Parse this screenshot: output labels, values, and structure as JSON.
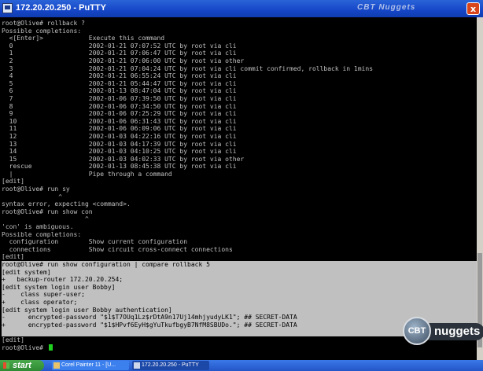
{
  "window": {
    "title": "172.20.20.250 - PuTTY",
    "watermark": "CBT Nuggets",
    "close_label": "x"
  },
  "terminal": {
    "lines": [
      "root@Olive# rollback ?",
      "Possible completions:",
      "  <[Enter]>            Execute this command",
      "  0                    2002-01-21 07:07:52 UTC by root via cli",
      "  1                    2002-01-21 07:06:47 UTC by root via cli",
      "  2                    2002-01-21 07:06:00 UTC by root via other",
      "  3                    2002-01-21 07:04:24 UTC by root via cli commit confirmed, rollback in 1mins",
      "  4                    2002-01-21 06:55:24 UTC by root via cli",
      "  5                    2002-01-21 05:44:47 UTC by root via cli",
      "  6                    2002-01-13 08:47:04 UTC by root via cli",
      "  7                    2002-01-06 07:39:50 UTC by root via cli",
      "  8                    2002-01-06 07:34:50 UTC by root via cli",
      "  9                    2002-01-06 07:25:29 UTC by root via cli",
      "  10                   2002-01-06 06:31:43 UTC by root via cli",
      "  11                   2002-01-06 06:09:06 UTC by root via cli",
      "  12                   2002-01-03 04:22:16 UTC by root via cli",
      "  13                   2002-01-03 04:17:39 UTC by root via cli",
      "  14                   2002-01-03 04:10:25 UTC by root via cli",
      "  15                   2002-01-03 04:02:33 UTC by root via other",
      "  rescue               2002-01-13 08:45:38 UTC by root via cli",
      "  |                    Pipe through a command",
      "[edit]",
      "root@Olive# run sy",
      "               ^",
      "syntax error, expecting <command>.",
      "root@Olive# run show con",
      "                      ^",
      "'con' is ambiguous.",
      "Possible completions:",
      "  configuration        Show current configuration",
      "  connections          Show circuit cross-connect connections",
      "[edit]",
      "root@Olive# run show configuration | compare rollback 5",
      "[edit system]",
      "+   backup-router 172.20.20.254;",
      "[edit system login user Bobby]",
      "-    class super-user;",
      "+    class operator;",
      "[edit system login user Bobby authentication]",
      "-      encrypted-password \"$1$T7OUq1Lz$rDtA9n17Uj14mhjyudyLK1\"; ## SECRET-DATA",
      "+      encrypted-password \"$1$HPvf6EyH$gYuTkufbgyB7NfM8SBUDo.\"; ## SECRET-DATA",
      "",
      "[edit]",
      "root@Olive# "
    ],
    "highlight_start": 32,
    "highlight_end": 41
  },
  "logo": {
    "disc": "CBT",
    "word": "nuggets"
  },
  "taskbar": {
    "start_label": "start",
    "tasks": [
      {
        "label": "Corel Painter 11 - [U..."
      },
      {
        "label": "172.20.20.250 - PuTTY"
      }
    ]
  }
}
